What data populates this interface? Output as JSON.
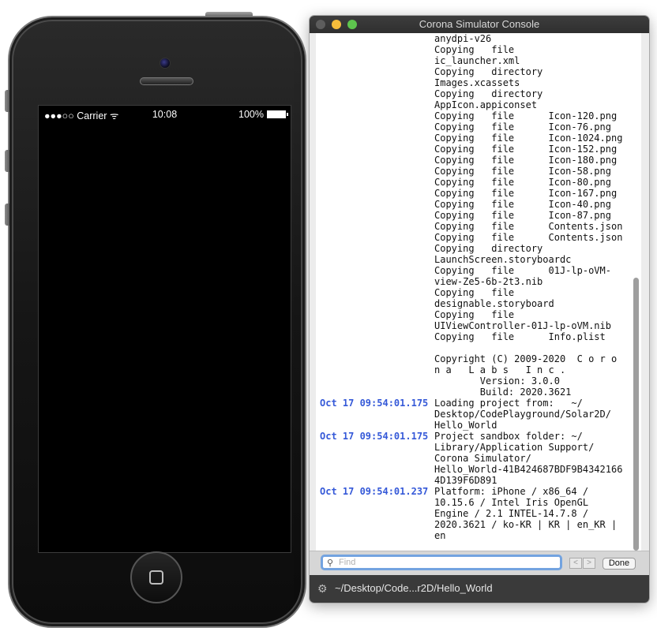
{
  "phone": {
    "status_bar": {
      "signal": "●●●○○",
      "carrier": "Carrier",
      "wifi": "ᯤ",
      "time": "10:08",
      "battery_percent": "100%"
    }
  },
  "console": {
    "title": "Corona Simulator Console",
    "log": [
      {
        "ts": "",
        "msg": "anydpi-v26"
      },
      {
        "ts": "",
        "msg": "Copying   file"
      },
      {
        "ts": "",
        "msg": "ic_launcher.xml"
      },
      {
        "ts": "",
        "msg": "Copying   directory"
      },
      {
        "ts": "",
        "msg": "Images.xcassets"
      },
      {
        "ts": "",
        "msg": "Copying   directory"
      },
      {
        "ts": "",
        "msg": "AppIcon.appiconset"
      },
      {
        "ts": "",
        "msg": "Copying   file      Icon-120.png"
      },
      {
        "ts": "",
        "msg": "Copying   file      Icon-76.png"
      },
      {
        "ts": "",
        "msg": "Copying   file      Icon-1024.png"
      },
      {
        "ts": "",
        "msg": "Copying   file      Icon-152.png"
      },
      {
        "ts": "",
        "msg": "Copying   file      Icon-180.png"
      },
      {
        "ts": "",
        "msg": "Copying   file      Icon-58.png"
      },
      {
        "ts": "",
        "msg": "Copying   file      Icon-80.png"
      },
      {
        "ts": "",
        "msg": "Copying   file      Icon-167.png"
      },
      {
        "ts": "",
        "msg": "Copying   file      Icon-40.png"
      },
      {
        "ts": "",
        "msg": "Copying   file      Icon-87.png"
      },
      {
        "ts": "",
        "msg": "Copying   file      Contents.json"
      },
      {
        "ts": "",
        "msg": "Copying   file      Contents.json"
      },
      {
        "ts": "",
        "msg": "Copying   directory"
      },
      {
        "ts": "",
        "msg": "LaunchScreen.storyboardc"
      },
      {
        "ts": "",
        "msg": "Copying   file      01J-lp-oVM-"
      },
      {
        "ts": "",
        "msg": "view-Ze5-6b-2t3.nib"
      },
      {
        "ts": "",
        "msg": "Copying   file"
      },
      {
        "ts": "",
        "msg": "designable.storyboard"
      },
      {
        "ts": "",
        "msg": "Copying   file"
      },
      {
        "ts": "",
        "msg": "UIViewController-01J-lp-oVM.nib"
      },
      {
        "ts": "",
        "msg": "Copying   file      Info.plist"
      },
      {
        "ts": "",
        "msg": " "
      },
      {
        "ts": "",
        "msg": "Copyright (C) 2009-2020  C o r o"
      },
      {
        "ts": "",
        "msg": "n a   L a b s   I n c ."
      },
      {
        "ts": "",
        "msg": "        Version: 3.0.0"
      },
      {
        "ts": "",
        "msg": "        Build: 2020.3621"
      },
      {
        "ts": "Oct 17 09:54:01.175",
        "msg": "Loading project from:   ~/"
      },
      {
        "ts": "",
        "msg": "Desktop/CodePlayground/Solar2D/"
      },
      {
        "ts": "",
        "msg": "Hello_World"
      },
      {
        "ts": "Oct 17 09:54:01.175",
        "msg": "Project sandbox folder: ~/"
      },
      {
        "ts": "",
        "msg": "Library/Application Support/"
      },
      {
        "ts": "",
        "msg": "Corona Simulator/"
      },
      {
        "ts": "",
        "msg": "Hello_World-41B424687BDF9B4342166"
      },
      {
        "ts": "",
        "msg": "4D139F6D891"
      },
      {
        "ts": "Oct 17 09:54:01.237",
        "msg": "Platform: iPhone / x86_64 /"
      },
      {
        "ts": "",
        "msg": "10.15.6 / Intel Iris OpenGL"
      },
      {
        "ts": "",
        "msg": "Engine / 2.1 INTEL-14.7.8 /"
      },
      {
        "ts": "",
        "msg": "2020.3621 / ko-KR | KR | en_KR |"
      },
      {
        "ts": "",
        "msg": "en"
      }
    ],
    "find": {
      "placeholder": "Find",
      "prev": "<",
      "next": ">",
      "done_label": "Done"
    },
    "path": "~/Desktop/Code...r2D/Hello_World",
    "icons": {
      "search": "search-icon",
      "gear": "gear-icon"
    }
  }
}
